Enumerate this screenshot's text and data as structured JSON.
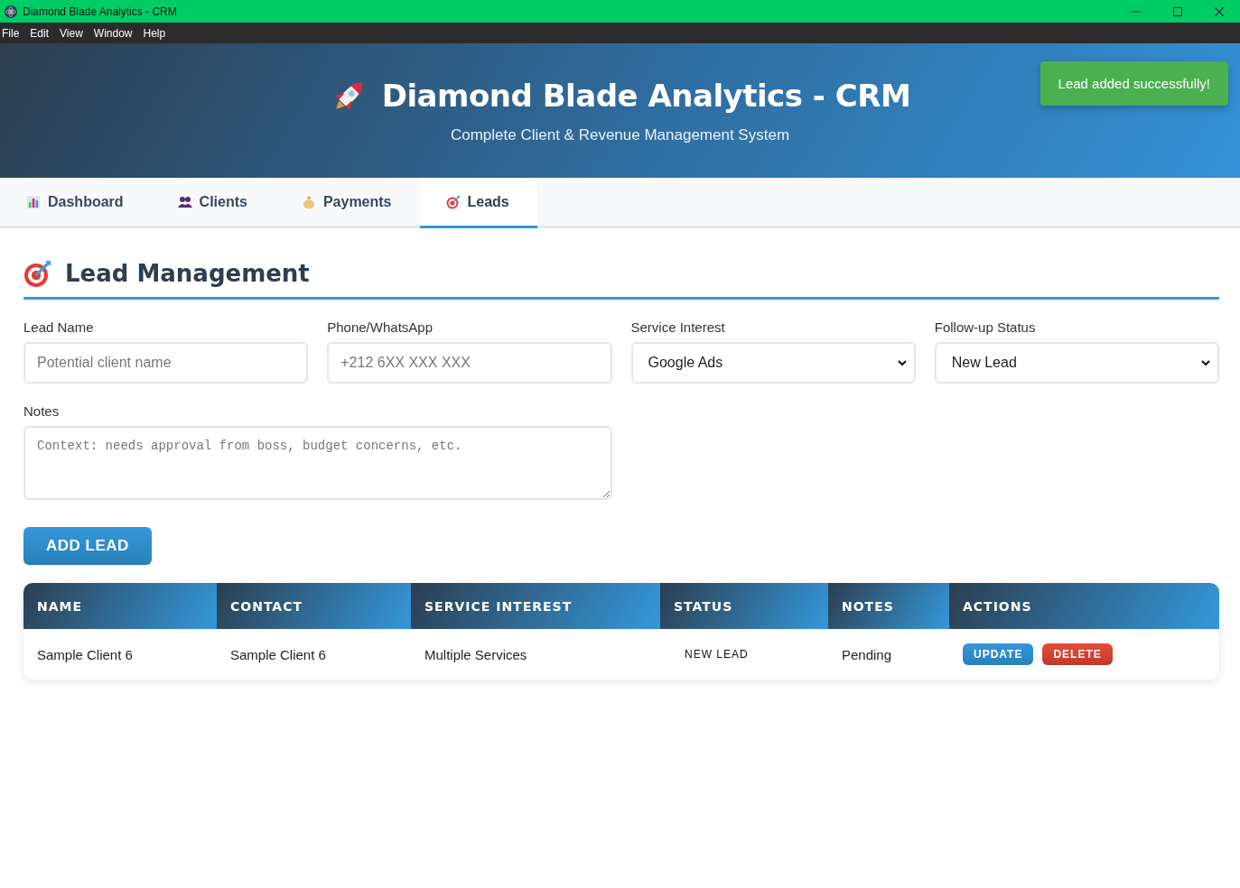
{
  "window": {
    "title": "Diamond Blade Analytics - CRM"
  },
  "menu": [
    "File",
    "Edit",
    "View",
    "Window",
    "Help"
  ],
  "header": {
    "title": "Diamond Blade Analytics - CRM",
    "subtitle": "Complete Client & Revenue Management System"
  },
  "toast": {
    "text": "Lead added successfully!"
  },
  "tabs": [
    {
      "label": "Dashboard",
      "kind": "chart",
      "selected": false
    },
    {
      "label": "Clients",
      "kind": "people",
      "selected": false
    },
    {
      "label": "Payments",
      "kind": "moneybag",
      "selected": false
    },
    {
      "label": "Leads",
      "kind": "target",
      "selected": true
    }
  ],
  "section": {
    "title": "Lead Management"
  },
  "fields": [
    {
      "kind": "input",
      "label": "Lead Name",
      "placeholder": "Potential client name"
    },
    {
      "kind": "input",
      "label": "Phone/WhatsApp",
      "placeholder": "+212 6XX XXX XXX"
    },
    {
      "kind": "select",
      "label": "Service Interest",
      "value": "Google Ads"
    },
    {
      "kind": "select",
      "label": "Follow-up Status",
      "value": "New Lead"
    },
    {
      "kind": "textarea",
      "label": "Notes",
      "placeholder": "Context: needs approval from boss, budget concerns, etc."
    }
  ],
  "add_button": "ADD LEAD",
  "table": {
    "columns": [
      "NAME",
      "CONTACT",
      "SERVICE INTEREST",
      "STATUS",
      "NOTES",
      "ACTIONS"
    ],
    "rows": [
      {
        "name": "Sample Client 6",
        "contact": "Sample Client 6",
        "service": "Multiple Services",
        "status": "NEW LEAD",
        "notes": "Pending",
        "actions": [
          {
            "kind": "update",
            "label": "UPDATE"
          },
          {
            "kind": "delete",
            "label": "DELETE"
          }
        ]
      }
    ]
  }
}
